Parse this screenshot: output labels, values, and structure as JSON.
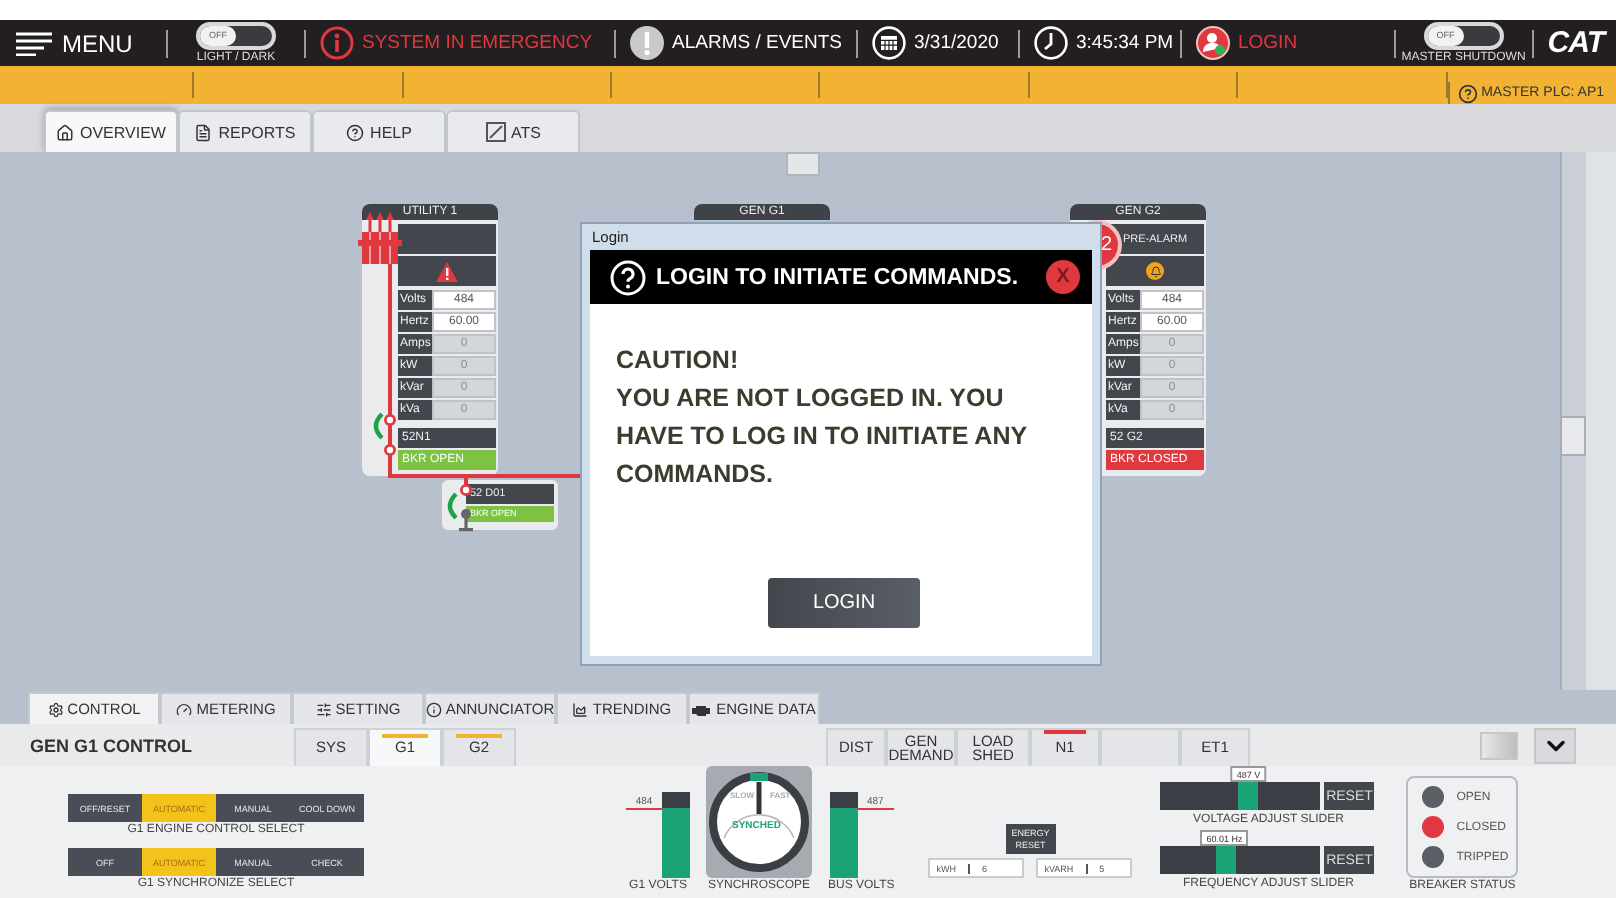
{
  "top_bar": {
    "menu": "MENU",
    "light_dark": {
      "knob": "OFF",
      "label": "LIGHT / DARK",
      "on": false
    },
    "emergency": "SYSTEM IN EMERGENCY",
    "alarms": "ALARMS / EVENTS",
    "date": "3/31/2020",
    "time": "3:45:34 PM",
    "login": "LOGIN",
    "master_shutdown": {
      "knob": "OFF",
      "label": "MASTER SHUTDOWN",
      "on": false
    },
    "logo": "CAT"
  },
  "status_strip": {
    "plc": "MASTER PLC: AP1"
  },
  "tabs": [
    {
      "label": "OVERVIEW",
      "selected": true
    },
    {
      "label": "REPORTS",
      "selected": false
    },
    {
      "label": "HELP",
      "selected": false
    },
    {
      "label": "ATS",
      "selected": false
    }
  ],
  "diagram": {
    "utility": {
      "title": "UTILITY 1",
      "readings": [
        {
          "label": "Volts",
          "value": "484",
          "active": true
        },
        {
          "label": "Hertz",
          "value": "60.00",
          "active": true
        },
        {
          "label": "Amps",
          "value": "0",
          "active": false
        },
        {
          "label": "kW",
          "value": "0",
          "active": false
        },
        {
          "label": "kVar",
          "value": "0",
          "active": false
        },
        {
          "label": "kVa",
          "value": "0",
          "active": false
        }
      ],
      "breaker": "52N1",
      "breaker_status": "BKR OPEN",
      "closed": false
    },
    "gen_g1": {
      "title": "GEN G1"
    },
    "gen_g2": {
      "title": "GEN G2",
      "badge": "2",
      "alarm": "PRE-ALARM",
      "readings": [
        {
          "label": "Volts",
          "value": "484",
          "active": true
        },
        {
          "label": "Hertz",
          "value": "60.00",
          "active": true
        },
        {
          "label": "Amps",
          "value": "0",
          "active": false
        },
        {
          "label": "kW",
          "value": "0",
          "active": false
        },
        {
          "label": "kVar",
          "value": "0",
          "active": false
        },
        {
          "label": "kVa",
          "value": "0",
          "active": false
        }
      ],
      "breaker": "52 G2",
      "breaker_status": "BKR CLOSED",
      "closed": true
    },
    "feeder": {
      "breaker": "52 D01",
      "breaker_status": "BKR OPEN",
      "closed": false
    }
  },
  "dialog": {
    "title": "Login",
    "heading": "LOGIN TO INITIATE COMMANDS.",
    "close": "X",
    "caution": "CAUTION!",
    "message": "YOU ARE NOT LOGGED IN. YOU HAVE TO LOG IN TO INITIATE ANY COMMANDS.",
    "button": "LOGIN"
  },
  "bottom_tabs": [
    {
      "label": "CONTROL",
      "selected": true
    },
    {
      "label": "METERING",
      "selected": false
    },
    {
      "label": "SETTING",
      "selected": false
    },
    {
      "label": "ANNUNCIATOR",
      "selected": false
    },
    {
      "label": "TRENDING",
      "selected": false
    },
    {
      "label": "ENGINE DATA",
      "selected": false
    }
  ],
  "control": {
    "title": "GEN G1 CONTROL",
    "subtabs": [
      {
        "label": "SYS",
        "selected": false
      },
      {
        "label": "G1",
        "selected": true,
        "color": "#f2b233"
      },
      {
        "label": "G2",
        "selected": false,
        "color": "#f2b233"
      }
    ],
    "subtabs_right": [
      {
        "label": "DIST",
        "selected": false
      },
      {
        "label": "GEN DEMAND",
        "selected": false
      },
      {
        "label": "LOAD SHED",
        "selected": false
      },
      {
        "label": "N1",
        "selected": false,
        "color": "#e0383f"
      },
      {
        "selected": false
      },
      {
        "label": "ET1",
        "selected": false
      }
    ],
    "selects": [
      {
        "caption": "G1 ENGINE CONTROL SELECT",
        "options": [
          {
            "label": "OFF/RESET",
            "selected": false
          },
          {
            "label": "AUTOMATIC",
            "selected": true
          },
          {
            "label": "MANUAL",
            "selected": false
          },
          {
            "label": "COOL DOWN",
            "selected": false
          }
        ]
      },
      {
        "caption": "G1 SYNCHRONIZE SELECT",
        "options": [
          {
            "label": "OFF",
            "selected": false
          },
          {
            "label": "AUTOMATIC",
            "selected": true
          },
          {
            "label": "MANUAL",
            "selected": false
          },
          {
            "label": "CHECK",
            "selected": false
          }
        ]
      }
    ],
    "meters": [
      {
        "reading": "484",
        "caption": "G1 VOLTS",
        "level": 0.82
      },
      {
        "reading": "487",
        "caption": "BUS VOLTS",
        "level": 0.82
      }
    ],
    "synchroscope": {
      "slow": "SLOW",
      "fast": "FAST",
      "status": "SYNCHED",
      "caption": "SYNCHROSCOPE"
    },
    "energy": {
      "reset": "ENERGY RESET",
      "fields": [
        {
          "label": "kWH",
          "value": "6"
        },
        {
          "label": "kVARH",
          "value": "5"
        }
      ]
    },
    "sliders": [
      {
        "readout": "487 V",
        "level": 0.55,
        "reset": "RESET",
        "caption": "VOLTAGE ADJUST SLIDER"
      },
      {
        "readout": "60.01 Hz",
        "level": 0.4,
        "reset": "RESET",
        "caption": "FREQUENCY ADJUST SLIDER"
      }
    ],
    "breaker_status": {
      "caption": "BREAKER STATUS",
      "lamps": [
        {
          "label": "OPEN",
          "lit": false
        },
        {
          "label": "CLOSED",
          "lit": true
        },
        {
          "label": "TRIPPED",
          "lit": false
        }
      ]
    }
  }
}
